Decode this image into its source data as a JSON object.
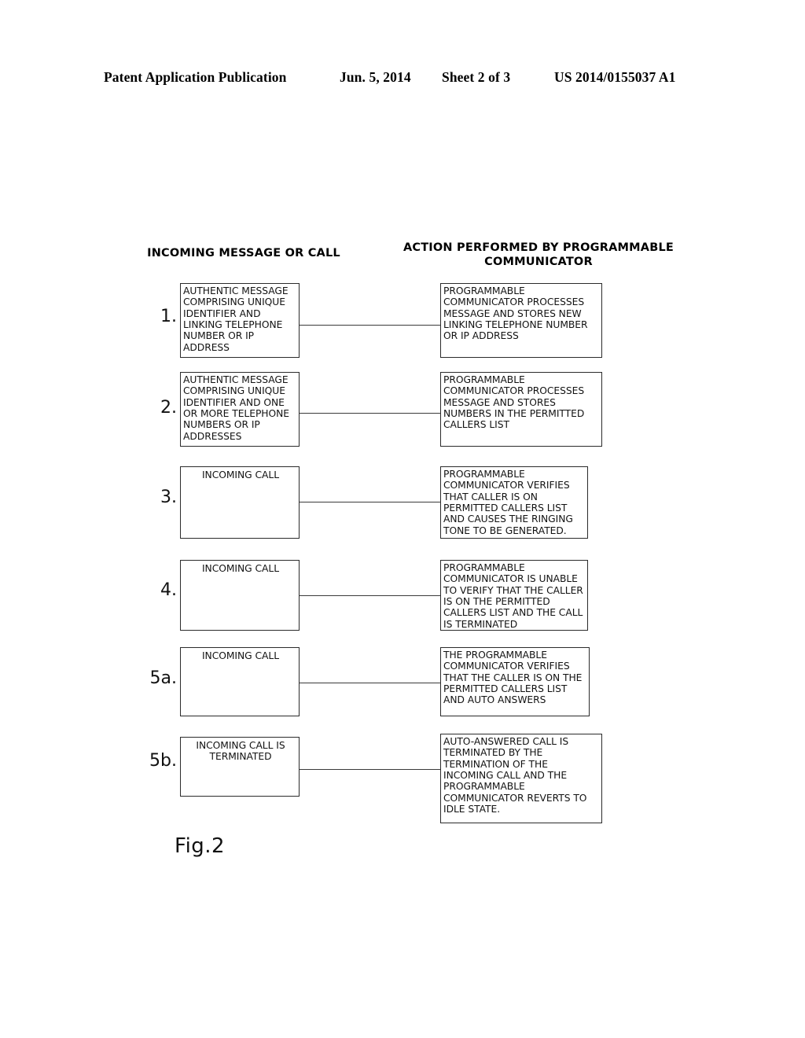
{
  "page_header": {
    "publication": "Patent Application Publication",
    "date": "Jun. 5, 2014",
    "sheet": "Sheet 2 of 3",
    "patent_number": "US 2014/0155037 A1"
  },
  "columns": {
    "left_heading": "INCOMING MESSAGE OR CALL",
    "right_heading": "ACTION PERFORMED BY\nPROGRAMMABLE COMMUNICATOR"
  },
  "figure": {
    "label": "Fig.2"
  },
  "rows": [
    {
      "number": "1.",
      "left_text": "AUTHENTIC MESSAGE\nCOMPRISING UNIQUE\nIDENTIFIER AND\nLINKING TELEPHONE\nNUMBER OR IP\nADDRESS",
      "right_text": "PROGRAMMABLE\nCOMMUNICATOR PROCESSES\nMESSAGE AND STORES NEW\nLINKING TELEPHONE NUMBER\nOR IP ADDRESS",
      "left_align": "left"
    },
    {
      "number": "2.",
      "left_text": "AUTHENTIC MESSAGE\nCOMPRISING UNIQUE\nIDENTIFIER AND ONE\nOR MORE TELEPHONE\nNUMBERS OR IP\nADDRESSES",
      "right_text": "PROGRAMMABLE\nCOMMUNICATOR PROCESSES\nMESSAGE AND STORES\nNUMBERS IN THE PERMITTED\nCALLERS LIST",
      "left_align": "left"
    },
    {
      "number": "3.",
      "left_text": "INCOMING CALL",
      "right_text": "PROGRAMMABLE\nCOMMUNICATOR VERIFIES\nTHAT CALLER IS ON\nPERMITTED CALLERS LIST\nAND CAUSES THE RINGING\nTONE TO BE GENERATED.",
      "left_align": "center"
    },
    {
      "number": "4.",
      "left_text": "INCOMING CALL",
      "right_text": "PROGRAMMABLE\nCOMMUNICATOR IS UNABLE\nTO VERIFY THAT THE CALLER\nIS ON THE PERMITTED\nCALLERS LIST AND THE CALL\nIS TERMINATED",
      "left_align": "center"
    },
    {
      "number": "5a.",
      "left_text": "INCOMING CALL",
      "right_text": "THE PROGRAMMABLE\nCOMMUNICATOR VERIFIES\nTHAT THE CALLER IS ON THE\nPERMITTED CALLERS LIST\nAND AUTO ANSWERS",
      "left_align": "center"
    },
    {
      "number": "5b.",
      "left_text": "INCOMING CALL IS\nTERMINATED",
      "right_text": "AUTO-ANSWERED CALL IS\nTERMINATED BY THE\nTERMINATION OF THE\nINCOMING CALL AND THE\nPROGRAMMABLE\nCOMMUNICATOR REVERTS TO\nIDLE STATE.",
      "left_align": "center"
    }
  ]
}
